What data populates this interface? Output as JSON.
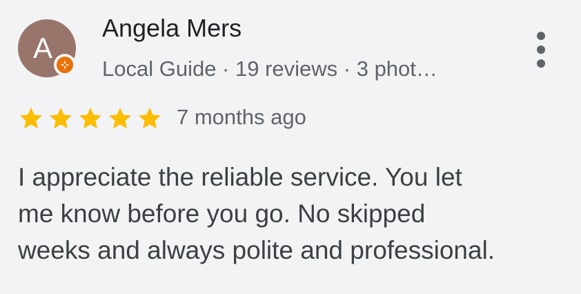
{
  "review": {
    "reviewer": {
      "avatar_initial": "A",
      "avatar_color": "#98756a",
      "name": "Angela Mers",
      "badge_icon": "local-guide-badge-icon",
      "badge_color": "#e8710a",
      "meta": "Local Guide · 19 reviews · 3 phot…"
    },
    "menu_icon": "more-vert-icon",
    "rating": {
      "value": 5,
      "max": 5,
      "star_icon": "star-icon",
      "star_color": "#fbbc04"
    },
    "age": "7 months ago",
    "lines": [
      "I appreciate the reliable service. You let",
      "me know before you go. No skipped",
      "weeks and always polite and professional."
    ]
  }
}
